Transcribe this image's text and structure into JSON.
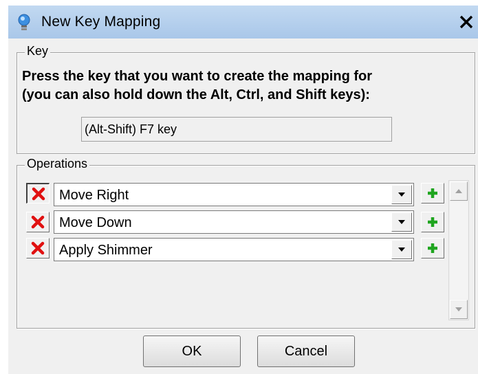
{
  "window": {
    "title": "New Key Mapping",
    "close_glyph": "✕",
    "icon": "lightbulb-icon"
  },
  "key_group": {
    "label": "Key",
    "instruction_line1": "Press the key that you want to create the mapping for",
    "instruction_line2": "(you can also hold down the Alt, Ctrl, and Shift keys):",
    "key_value": "(Alt-Shift) F7 key"
  },
  "operations_group": {
    "label": "Operations",
    "rows": [
      {
        "operation": "Move Right",
        "remove_icon": "remove-x-icon",
        "add_icon": "add-plus-icon"
      },
      {
        "operation": "Move Down",
        "remove_icon": "remove-x-icon",
        "add_icon": "add-plus-icon"
      },
      {
        "operation": "Apply Shimmer",
        "remove_icon": "remove-x-icon",
        "add_icon": "add-plus-icon"
      }
    ]
  },
  "buttons": {
    "ok": "OK",
    "cancel": "Cancel"
  },
  "colors": {
    "titlebar": "#b7d0ee",
    "remove_red": "#e01010",
    "add_green": "#1fa51f"
  }
}
